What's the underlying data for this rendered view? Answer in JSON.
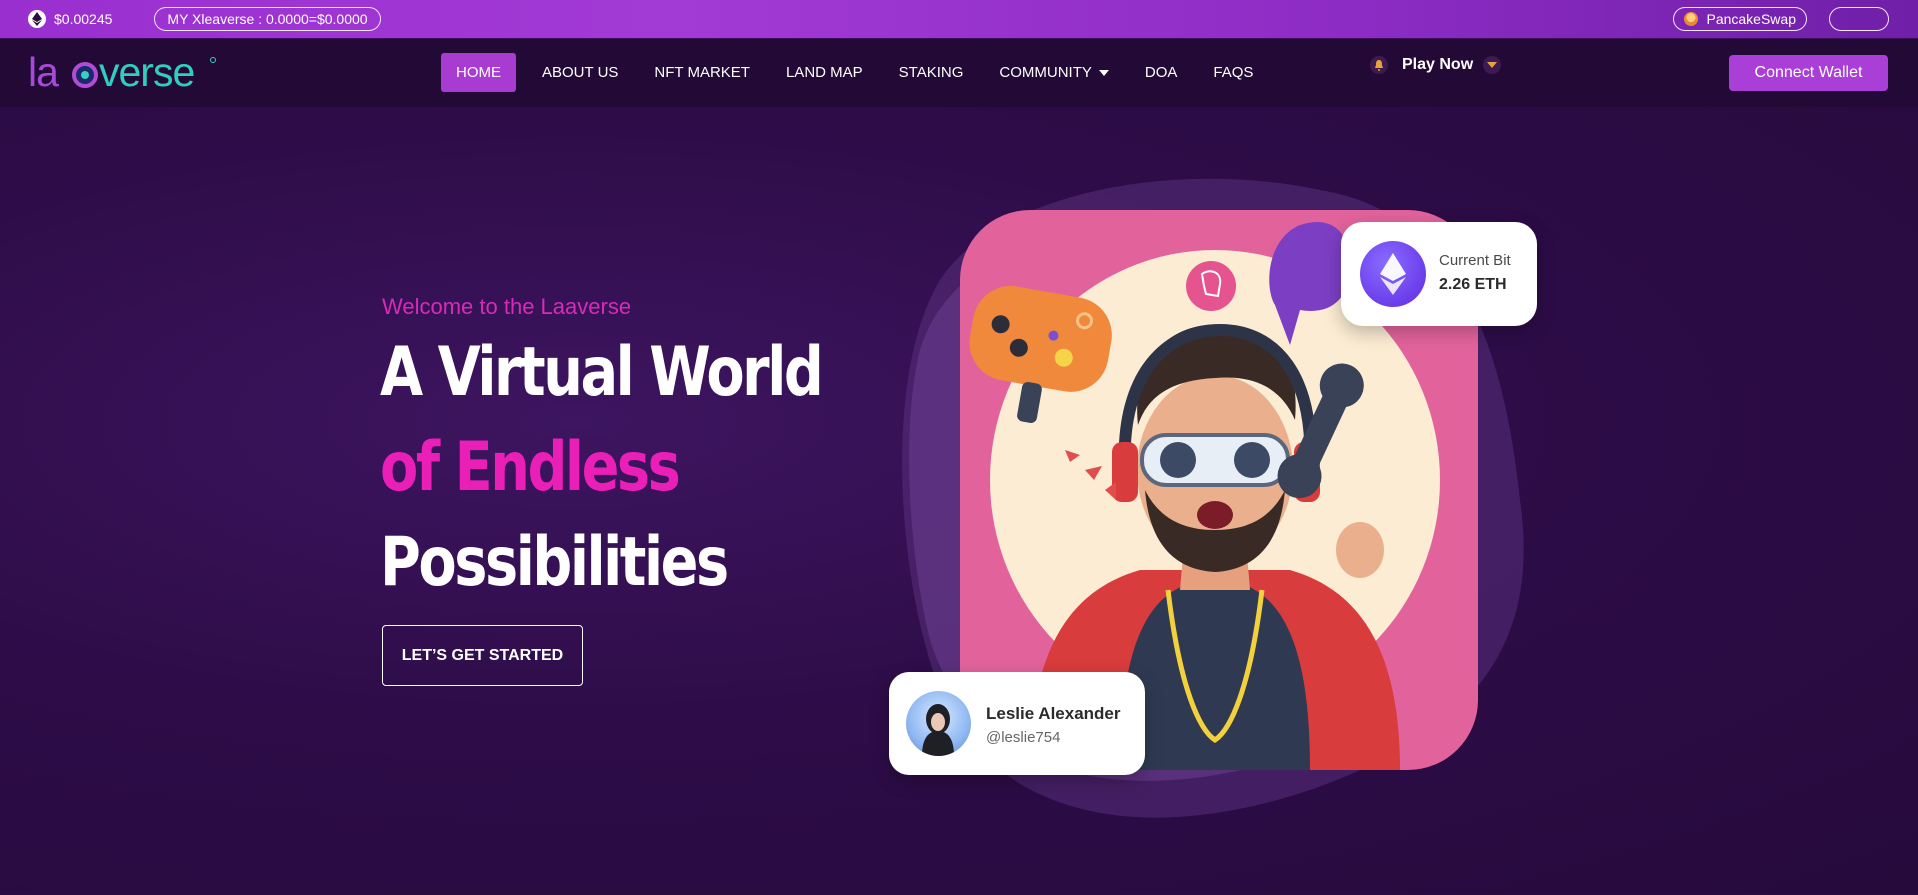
{
  "topbar": {
    "price": "$0.00245",
    "balance": "MY Xleaverse : 0.0000=$0.0000",
    "pancakeswap": "PancakeSwap",
    "empty_button": ""
  },
  "logo": {
    "text": "laaverse"
  },
  "nav": {
    "items": [
      {
        "label": "HOME",
        "active": true
      },
      {
        "label": "ABOUT US"
      },
      {
        "label": "NFT MARKET"
      },
      {
        "label": "LAND MAP"
      },
      {
        "label": "STAKING"
      },
      {
        "label": "COMMUNITY",
        "has_dropdown": true
      },
      {
        "label": "DOA"
      },
      {
        "label": "FAQS"
      }
    ],
    "play_now": "Play Now",
    "connect_wallet": "Connect Wallet"
  },
  "hero": {
    "welcome": "Welcome to the Laaverse",
    "line1": "A Virtual World",
    "line2": "of Endless",
    "line3": "Possibilities",
    "cta": "LET’S GET STARTED"
  },
  "bid_card": {
    "label": "Current Bit",
    "value": "2.26 ETH"
  },
  "user_card": {
    "name": "Leslie Alexander",
    "handle": "@leslie754"
  },
  "colors": {
    "accent_purple": "#a93fd6",
    "accent_pink": "#ea1fb8",
    "background": "#2a0d3f",
    "art_pink": "#e2639c"
  }
}
